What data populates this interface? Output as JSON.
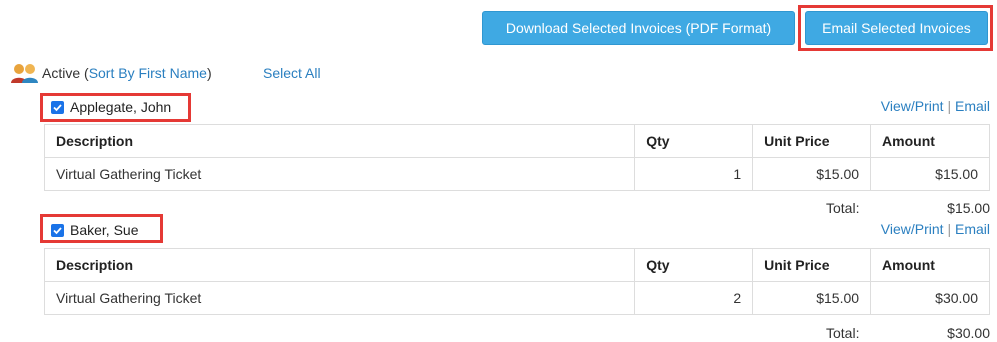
{
  "toolbar": {
    "download_label": "Download Selected Invoices (PDF Format)",
    "email_label": "Email Selected Invoices"
  },
  "group": {
    "label": "Active",
    "sort_link": "Sort By First Name",
    "select_all": "Select All"
  },
  "table_headers": [
    "Description",
    "Qty",
    "Unit Price",
    "Amount"
  ],
  "links": {
    "view_print": "View/Print",
    "separator": "|",
    "email": "Email"
  },
  "total_label": "Total:",
  "invoices": [
    {
      "name": "Applegate, John",
      "checked": true,
      "item": {
        "description": "Virtual Gathering Ticket",
        "qty": "1",
        "unit_price": "$15.00",
        "amount": "$15.00"
      },
      "total": "$15.00"
    },
    {
      "name": "Baker, Sue",
      "checked": true,
      "item": {
        "description": "Virtual Gathering Ticket",
        "qty": "2",
        "unit_price": "$15.00",
        "amount": "$30.00"
      },
      "total": "$30.00"
    }
  ],
  "colors": {
    "button": "#3fa9e3",
    "link": "#2a7fc0",
    "highlight": "#e53935",
    "checkbox": "#1a73e8"
  }
}
